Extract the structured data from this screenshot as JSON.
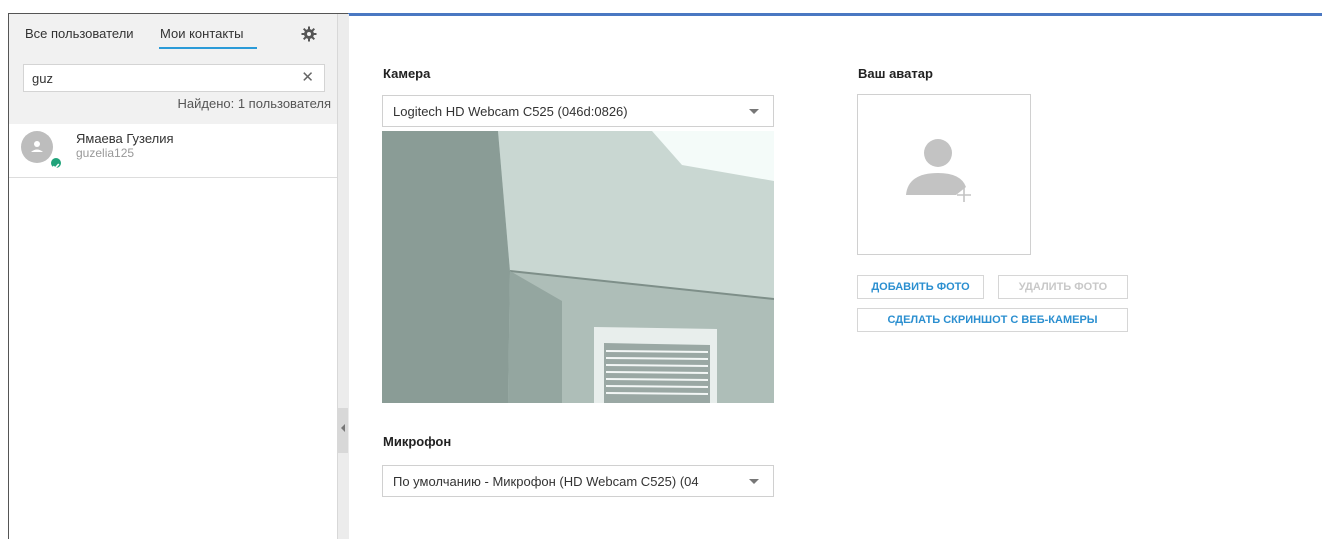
{
  "sidebar": {
    "tabs": [
      {
        "label": "Все пользователи",
        "active": false
      },
      {
        "label": "Мои контакты",
        "active": true
      }
    ],
    "settings_icon": "gear-icon",
    "search": {
      "value": "guz",
      "clear_icon": "close-icon",
      "clear_label": "✕"
    },
    "found_text": "Найдено: 1 пользователя",
    "contacts": [
      {
        "name": "Ямаева Гузелия",
        "login": "guzelia125",
        "status": "online",
        "status_color": "#1fa37a"
      }
    ]
  },
  "main": {
    "camera": {
      "label": "Камера",
      "selected": "Logitech HD Webcam C525 (046d:0826)"
    },
    "microphone": {
      "label": "Микрофон",
      "selected": "По умолчанию - Микрофон (HD Webcam C525) (04"
    },
    "avatar": {
      "label": "Ваш аватар",
      "icon": "add-user-icon",
      "add_photo": "ДОБАВИТЬ ФОТО",
      "delete_photo": "УДАЛИТЬ ФОТО",
      "webcam_snapshot": "СДЕЛАТЬ СКРИНШОТ С ВЕБ-КАМЕРЫ"
    }
  },
  "colors": {
    "accent": "#2b9bd8",
    "button_text": "#2b8fd0",
    "online": "#1fa37a"
  }
}
